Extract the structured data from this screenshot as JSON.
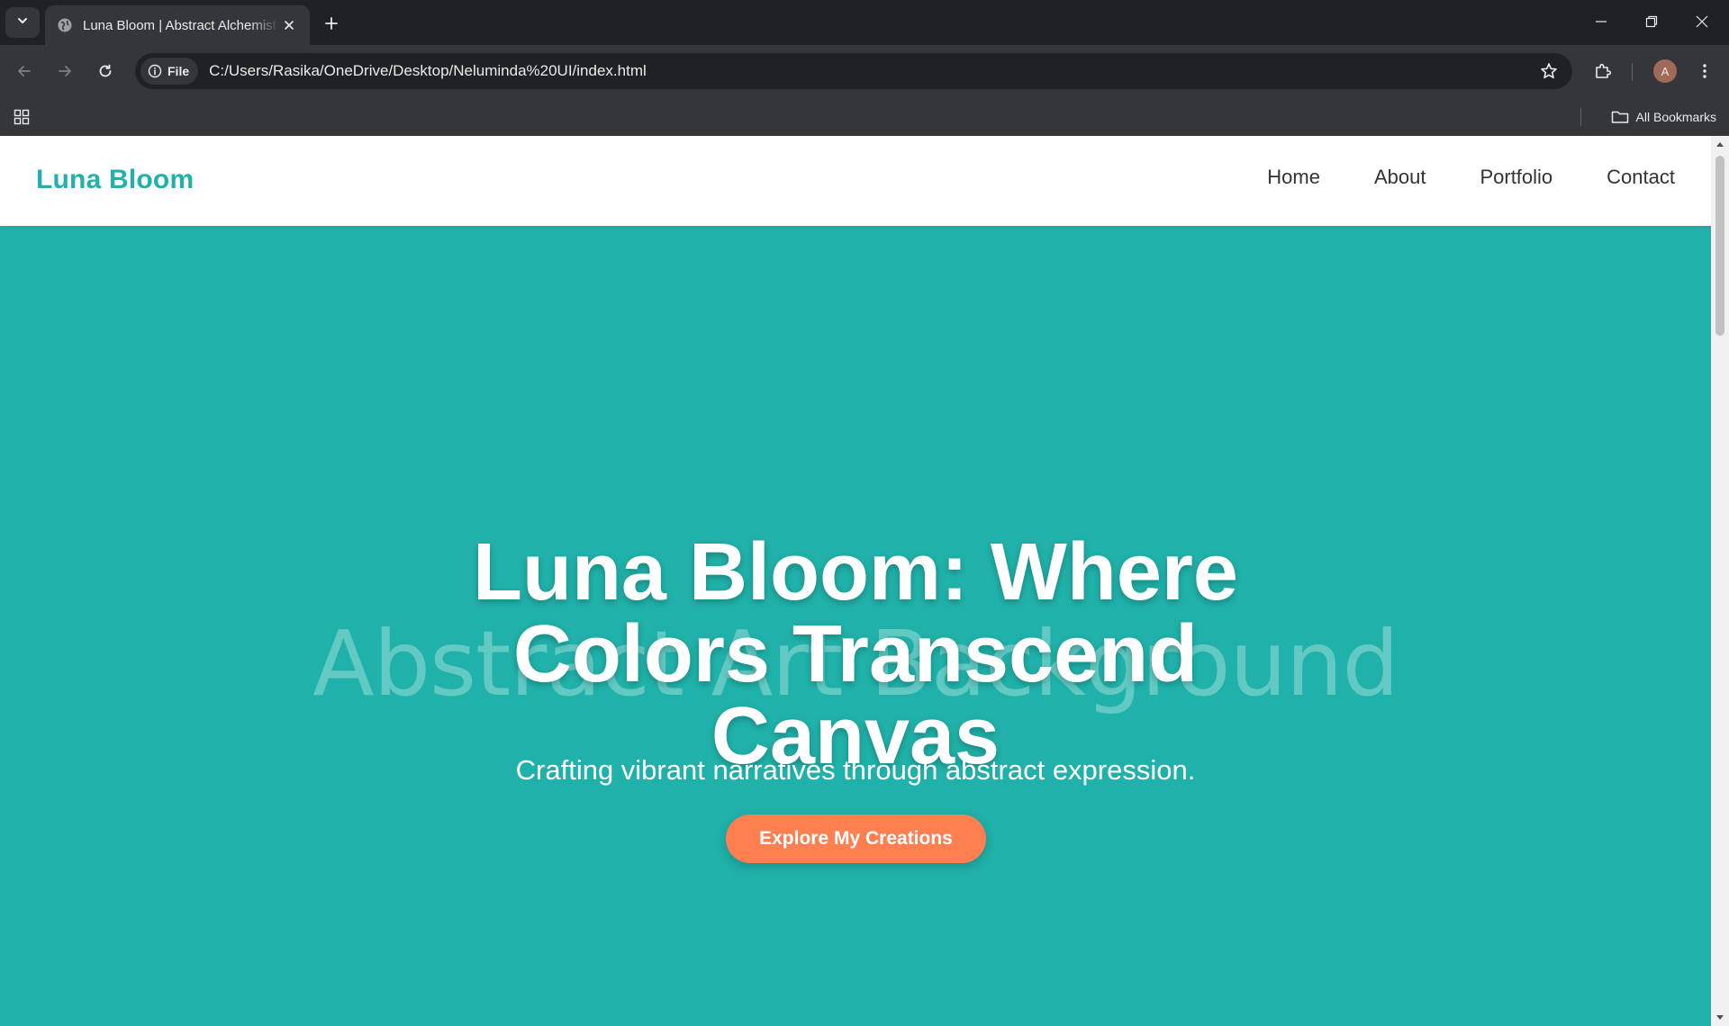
{
  "browser": {
    "tab_title": "Luna Bloom | Abstract Alchemist",
    "file_chip": "File",
    "url": "C:/Users/Rasika/OneDrive/Desktop/Neluminda%20UI/index.html",
    "bookmarks_label": "All Bookmarks",
    "profile_initial": "A"
  },
  "site": {
    "logo": "Luna Bloom",
    "nav": [
      "Home",
      "About",
      "Portfolio",
      "Contact"
    ]
  },
  "hero": {
    "background_alt": "Abstract Art Background",
    "title": "Luna Bloom: Where Colors Transcend Canvas",
    "subtitle": "Crafting vibrant narratives through abstract expression.",
    "cta": "Explore My Creations"
  },
  "colors": {
    "accent": "#20b2aa",
    "cta": "#ff7f50",
    "chrome_dark": "#202124",
    "chrome_mid": "#35363a"
  }
}
